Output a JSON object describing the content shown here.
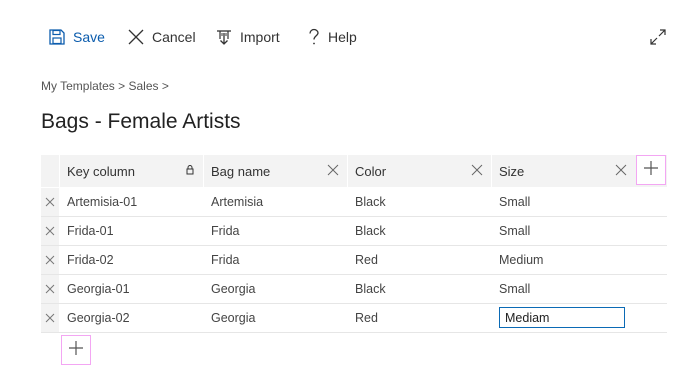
{
  "toolbar": {
    "save_label": "Save",
    "cancel_label": "Cancel",
    "import_label": "Import",
    "help_label": "Help"
  },
  "breadcrumb": "My Templates > Sales >",
  "page_title": "Bags - Female Artists",
  "grid": {
    "columns": [
      "Key column",
      "Bag name",
      "Color",
      "Size"
    ],
    "rows": [
      [
        "Artemisia-01",
        "Artemisia",
        "Black",
        "Small"
      ],
      [
        "Frida-01",
        "Frida",
        "Black",
        "Small"
      ],
      [
        "Frida-02",
        "Frida",
        "Red",
        "Medium"
      ],
      [
        "Georgia-01",
        "Georgia",
        "Black",
        "Small"
      ],
      [
        "Georgia-02",
        "Georgia",
        "Red",
        ""
      ]
    ],
    "editing_value": "Mediam"
  },
  "colors": {
    "accent": "#0b5cad",
    "header_bg": "#f3f3f3",
    "highlight_border": "#f3a6f3",
    "edit_border": "#0b6ab5"
  },
  "icons": [
    "save-icon",
    "cancel-icon",
    "import-icon",
    "help-icon",
    "expand-icon",
    "lock-icon",
    "close-icon",
    "plus-icon"
  ]
}
